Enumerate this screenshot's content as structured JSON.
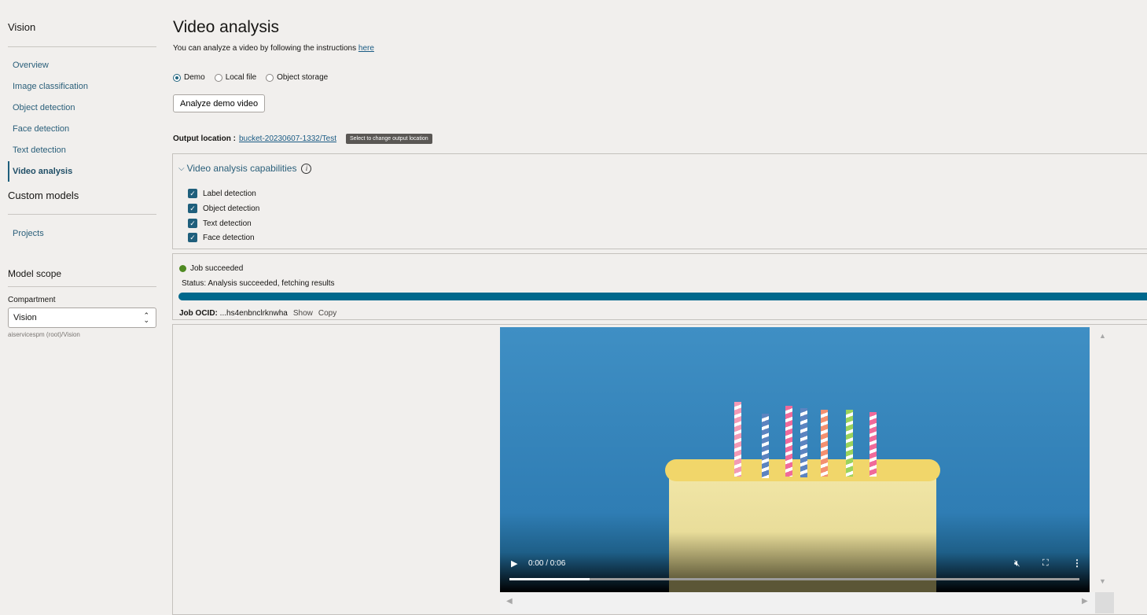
{
  "sidebar": {
    "title": "Vision",
    "items": [
      {
        "label": "Overview"
      },
      {
        "label": "Image classification"
      },
      {
        "label": "Object detection"
      },
      {
        "label": "Face detection"
      },
      {
        "label": "Text detection"
      },
      {
        "label": "Video analysis",
        "active": true
      }
    ],
    "custom_title": "Custom models",
    "custom_items": [
      {
        "label": "Projects"
      }
    ],
    "scope_title": "Model scope",
    "compartment_label": "Compartment",
    "compartment_value": "Vision",
    "compartment_path": "aiservicespm (root)/Vision"
  },
  "main": {
    "title": "Video analysis",
    "subtitle": "You can analyze a video by following the instructions",
    "subtitle_link": "here",
    "sources": [
      {
        "label": "Demo",
        "selected": true
      },
      {
        "label": "Local file",
        "selected": false
      },
      {
        "label": "Object storage",
        "selected": false
      }
    ],
    "analyze_button": "Analyze demo video",
    "output_label": "Output location :",
    "output_value": "bucket-20230607-1332/Test",
    "output_tooltip": "Select to change output location",
    "capabilities_title": "Video analysis capabilities",
    "capabilities": [
      {
        "label": "Label detection",
        "checked": true
      },
      {
        "label": "Object detection",
        "checked": true
      },
      {
        "label": "Text detection",
        "checked": true
      },
      {
        "label": "Face detection",
        "checked": true
      }
    ],
    "job_state": "Job succeeded",
    "job_status": "Status: Analysis succeeded, fetching results",
    "job_progress_percent": 100,
    "job_ocid_label": "Job OCID:",
    "job_ocid_value": "...hs4enbnclrknwha",
    "show_label": "Show",
    "copy_label": "Copy",
    "colors": {
      "accent": "#006b8f",
      "success": "#4f8a22",
      "progress": "#00688c"
    }
  },
  "video": {
    "time": "0:00 / 0:06",
    "played_fraction": 0.14,
    "muted": true
  }
}
